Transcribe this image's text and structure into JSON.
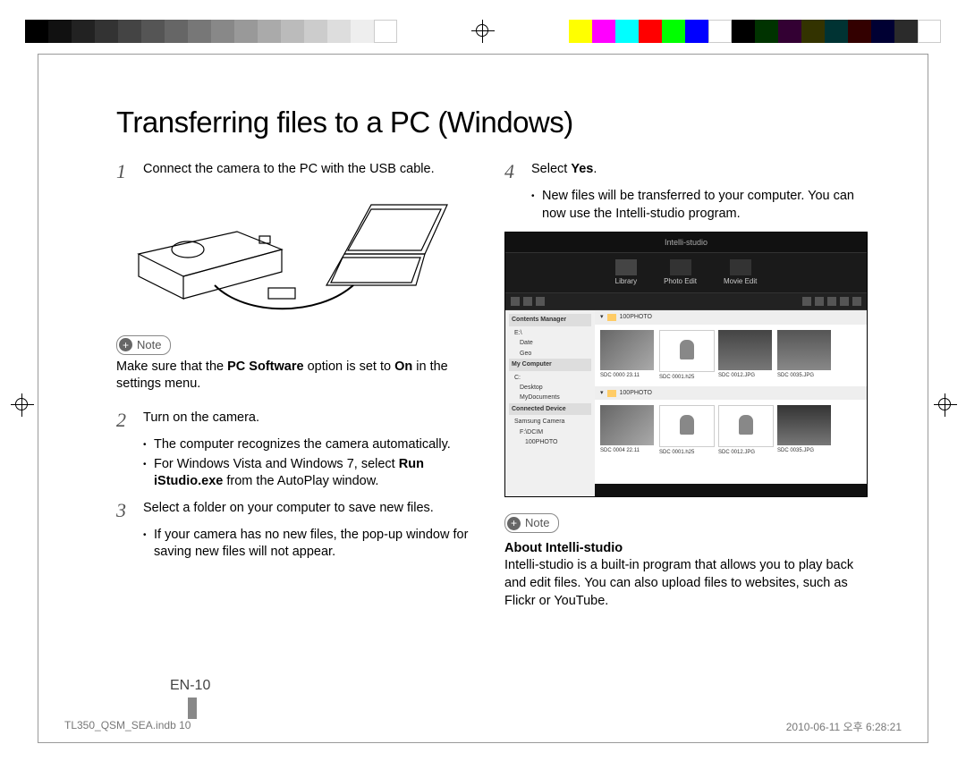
{
  "title": "Transferring files to a PC (Windows)",
  "steps": {
    "s1": {
      "num": "1",
      "text": "Connect the camera to the PC with the USB cable."
    },
    "note1_label": "Note",
    "note1_text_pre": "Make sure that the ",
    "note1_bold1": "PC Software",
    "note1_mid": " option is set to ",
    "note1_bold2": "On",
    "note1_post": " in the settings menu.",
    "s2": {
      "num": "2",
      "text": "Turn on the camera.",
      "bullets": [
        "The computer recognizes the camera automatically."
      ],
      "bullet2_pre": "For Windows Vista and Windows 7, select ",
      "bullet2_bold": "Run iStudio.exe",
      "bullet2_post": " from the AutoPlay window."
    },
    "s3": {
      "num": "3",
      "text": "Select a folder on your computer to save new files.",
      "bullets": [
        "If your camera has no new files, the pop-up window for saving new files will not appear."
      ]
    },
    "s4": {
      "num": "4",
      "text_pre": "Select ",
      "text_bold": "Yes",
      "text_post": ".",
      "bullets": [
        "New files will be transferred to your computer. You can now use the Intelli-studio program."
      ]
    },
    "note2_label": "Note",
    "note2_heading": "About Intelli-studio",
    "note2_text": "Intelli-studio is a built-in program that allows you to play back and edit files. You can also upload files to websites, such as Flickr or YouTube."
  },
  "screenshot": {
    "app_title": "Intelli-studio",
    "tabs": [
      "Library",
      "Photo Edit",
      "Movie Edit"
    ],
    "sidebar": {
      "section1": "Contents Manager",
      "nodes1": [
        "E:\\",
        "Date",
        "Geo"
      ],
      "section2": "My Computer",
      "nodes2": [
        "C:",
        "Desktop",
        "MyDocuments"
      ],
      "section3": "Connected Device",
      "nodes3": [
        "Samsung Camera",
        "F:\\DCIM",
        "100PHOTO"
      ]
    },
    "thumbs_top": [
      "SDC 0000    23.11",
      "SDC 0001.h25",
      "SDC 0012.JPG",
      "SDC 0035.JPG"
    ],
    "thumbs_bottom": [
      "SDC 0004    22.11",
      "SDC 0001.h25",
      "SDC 0012.JPG",
      "SDC 0035.JPG"
    ],
    "folder_label": "100PHOTO"
  },
  "page_number": "EN-10",
  "footer": {
    "left": "TL350_QSM_SEA.indb   10",
    "right": "2010-06-11   오후 6:28:21"
  }
}
